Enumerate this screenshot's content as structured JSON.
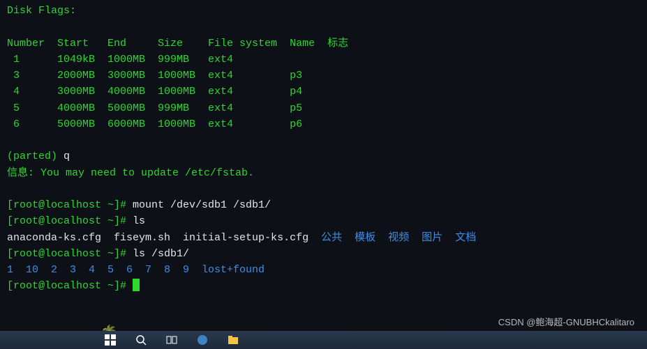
{
  "disk_flags_label": "Disk Flags:",
  "table_headers": [
    "Number",
    "Start",
    "End",
    "Size",
    "File system",
    "Name",
    "标志"
  ],
  "partitions": [
    {
      "num": "1",
      "start": "1049kB",
      "end": "1000MB",
      "size": "999MB",
      "fs": "ext4",
      "name": ""
    },
    {
      "num": "3",
      "start": "2000MB",
      "end": "3000MB",
      "size": "1000MB",
      "fs": "ext4",
      "name": "p3"
    },
    {
      "num": "4",
      "start": "3000MB",
      "end": "4000MB",
      "size": "1000MB",
      "fs": "ext4",
      "name": "p4"
    },
    {
      "num": "5",
      "start": "4000MB",
      "end": "5000MB",
      "size": "999MB",
      "fs": "ext4",
      "name": "p5"
    },
    {
      "num": "6",
      "start": "5000MB",
      "end": "6000MB",
      "size": "1000MB",
      "fs": "ext4",
      "name": "p6"
    }
  ],
  "parted_prompt": "(parted) ",
  "parted_cmd": "q",
  "info_line": "信息: You may need to update /etc/fstab.",
  "prompt": "[root@localhost ~]# ",
  "cmd_mount": "mount /dev/sdb1 /sdb1/",
  "cmd_ls1": "ls",
  "ls1_white": "anaconda-ks.cfg  fiseym.sh  initial-setup-ks.cfg  ",
  "ls1_blue": "公共  模板  视频  图片  文档",
  "cmd_ls2": "ls /sdb1/",
  "ls2_blue": "1  10  2  3  4  5  6  7  8  9  lost+found",
  "watermark": "CSDN @鲍海超-GNUBHCkalitaro"
}
